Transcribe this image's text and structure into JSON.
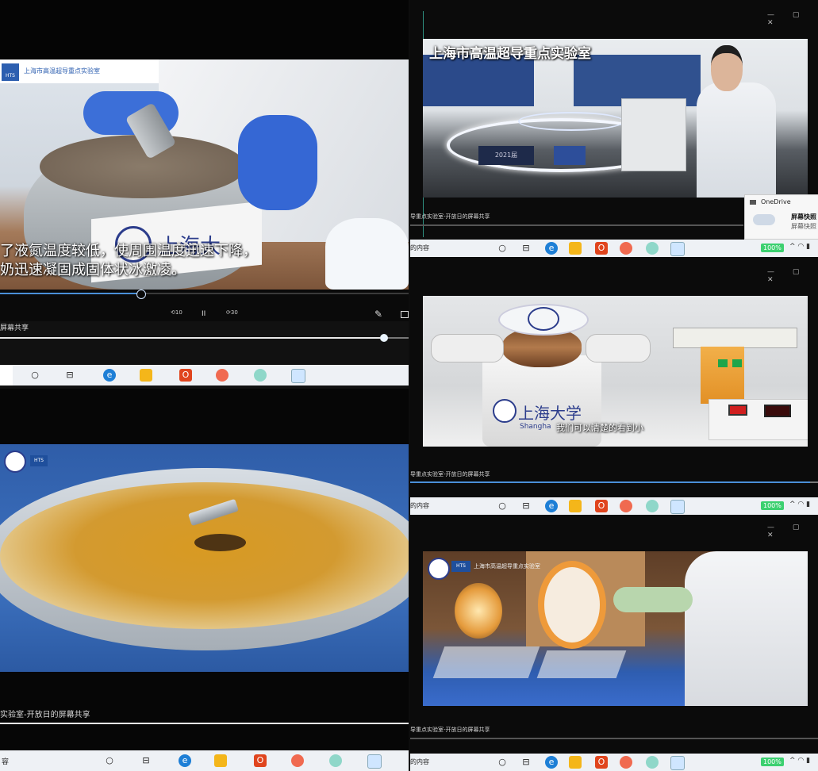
{
  "panels": {
    "top_left": {
      "subtitle_line1": "了液氮温度较低，使周围温度迅速下降，",
      "subtitle_line2": "奶迅速凝固成固体状冰激凌。",
      "logo_text": "上海市高温超导重点实验室",
      "logo_abbr": "HTS",
      "cup_text": "上海大",
      "share_caption": "屏幕共享",
      "progress_fraction": 0.93,
      "video_progress_fraction": 0.35,
      "control_rewind": "10",
      "control_forward": "30",
      "control_pause": "II"
    },
    "bottom_left": {
      "share_caption": "实验室-开放日的屏幕共享",
      "taskbar_text": "容",
      "logo_abbr": "HTS"
    },
    "top_right": {
      "overlay_title": "上海市高温超导重点实验室",
      "share_caption": "导重点实验室-开放日的屏幕共享",
      "taskbar_text": "的内容",
      "plaque_text": "2021届",
      "onedrive_title": "OneDrive",
      "onedrive_line1": "屏幕快照",
      "onedrive_line2": "屏幕快照",
      "battery": "100%"
    },
    "middle_right": {
      "subtitle": "我们可以清楚的看到小",
      "share_caption": "导重点实验室-开放日的屏幕共享",
      "taskbar_text": "的内容",
      "device_text": "上海大学",
      "device_text_en": "Shangha",
      "battery": "100%"
    },
    "bottom_right": {
      "share_caption": "导重点实验室-开放日的屏幕共享",
      "taskbar_text": "的内容",
      "battery": "100%",
      "logo_text": "上海市高温超导重点实验室",
      "logo_abbr": "HTS"
    }
  },
  "taskbar_icons": [
    "search-circle-icon",
    "task-view-icon",
    "edge-icon",
    "file-explorer-icon",
    "office-icon",
    "mail-icon",
    "settings-icon",
    "weather-icon"
  ],
  "colors": {
    "edge": "#1e7fd6",
    "explorer": "#f4b61a",
    "office": "#e0451e",
    "accent_battery": "#3cd070"
  }
}
